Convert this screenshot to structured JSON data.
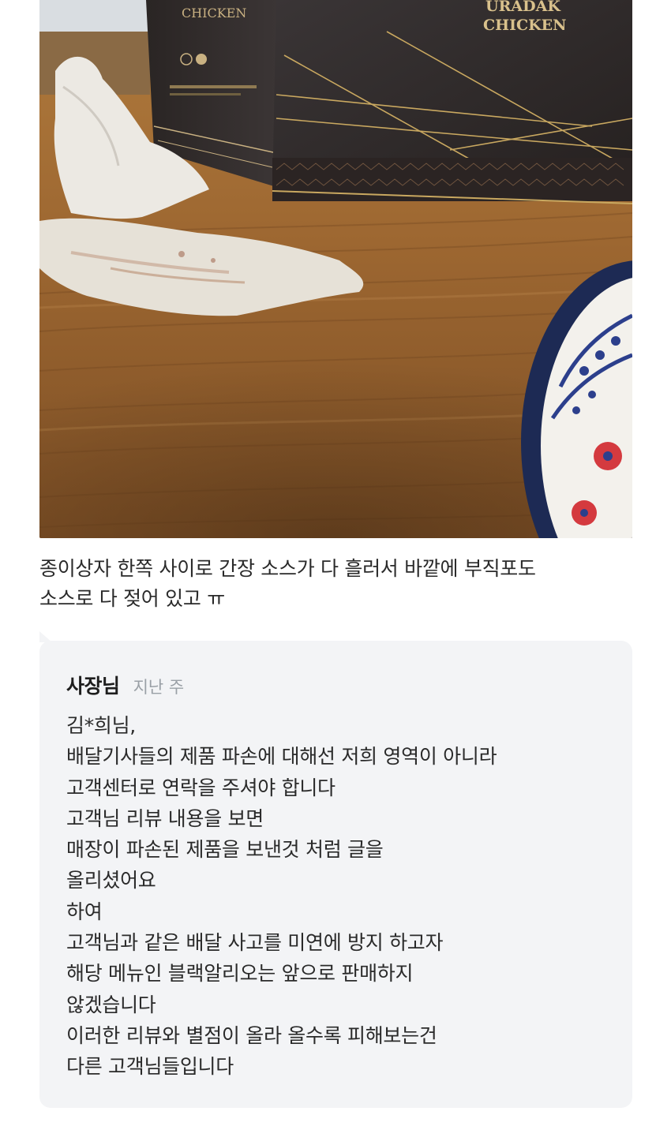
{
  "review": {
    "photo_label": "review-photo",
    "box_brand_left": "CHICKEN",
    "box_brand_right_top": "URADAK",
    "box_brand_right_bottom": "CHICKEN",
    "text_lines": [
      "종이상자 한쪽 사이로 간장 소스가 다 흘러서 바깥에 부직포도",
      "소스로 다 젖어 있고 ㅠ"
    ]
  },
  "reply": {
    "author": "사장님",
    "time": "지난 주",
    "lines": [
      "김*희님,",
      "배달기사들의 제품 파손에 대해선 저희 영역이 아니라",
      "고객센터로 연락을 주셔야 합니다",
      "고객님 리뷰 내용을 보면",
      "매장이 파손된 제품을 보낸것 처럼 글을",
      "올리셨어요",
      "하여",
      "고객님과 같은 배달 사고를 미연에 방지 하고자",
      "해당 메뉴인 블랙알리오는 앞으로  판매하지",
      "않겠습니다",
      "이러한 리뷰와 별점이 올라 올수록 피해보는건",
      "다른 고객님들입니다"
    ]
  },
  "colors": {
    "reply_background": "#f3f4f6",
    "time_text": "#9aa0a6",
    "body_text": "#2a2a2a"
  }
}
